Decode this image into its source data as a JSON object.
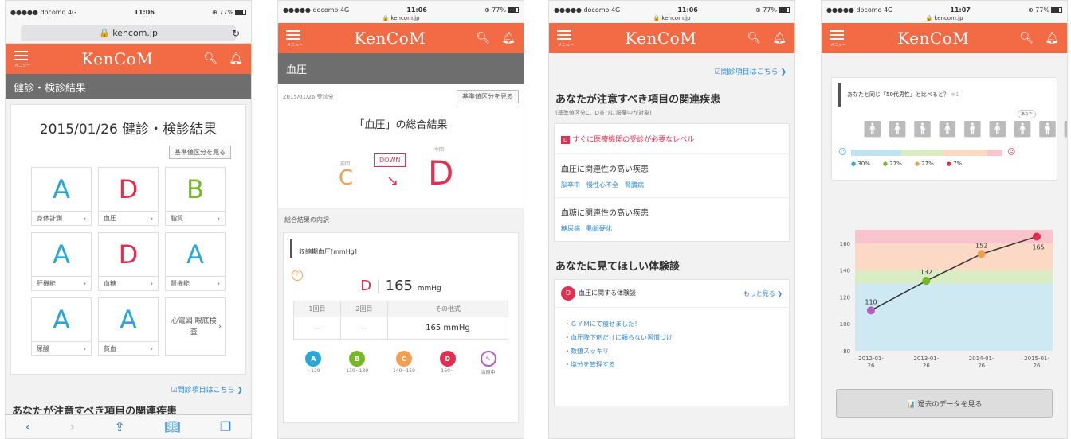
{
  "status": {
    "carrier": "●●●●● docomo 4G",
    "battery": "⊕ 77%"
  },
  "times": [
    "11:06",
    "11:06",
    "11:06",
    "11:07"
  ],
  "host": "kencom.jp",
  "lock_host": "🔒 kencom.jp",
  "host_small": "🔒 kencom.jp",
  "logo": "KenCoM",
  "menu_label": "メニュー",
  "s1": {
    "sub": "健診・検診結果",
    "title": "2015/01/26 健診・検診結果",
    "std": "基準値区分を見る",
    "cards": [
      {
        "g": "A",
        "l": "身体計測"
      },
      {
        "g": "D",
        "l": "血圧"
      },
      {
        "g": "B",
        "l": "脂質"
      },
      {
        "g": "A",
        "l": "肝機能"
      },
      {
        "g": "D",
        "l": "血糖"
      },
      {
        "g": "A",
        "l": "腎機能"
      },
      {
        "g": "A",
        "l": "尿酸"
      },
      {
        "g": "A",
        "l": "貧血"
      },
      {
        "g": "",
        "l": "心電図 眼底検査"
      }
    ],
    "link": "☑問診項目はこちら ❯",
    "heading": "あなたが注意すべき項目の関連疾患"
  },
  "s2": {
    "sub": "血圧",
    "date": "2015/01/26 受診分",
    "std": "基準値区分を見る",
    "title": "「血圧」の総合結果",
    "prev_label": "前回",
    "prev": "C",
    "down": "DOWN",
    "now_label": "今回",
    "now": "D",
    "breakdown": "総合結果の内訳",
    "item": "収縮期血圧[mmHg]",
    "q": "?",
    "grade": "D",
    "value": "165",
    "unit": "mmHg",
    "cols": [
      "1回目",
      "2回目",
      "その他式"
    ],
    "cells": [
      "—",
      "—",
      "165 mmHg"
    ],
    "legend": [
      {
        "k": "A",
        "t": "~129"
      },
      {
        "k": "B",
        "t": "130~139"
      },
      {
        "k": "C",
        "t": "140~159"
      },
      {
        "k": "D",
        "t": "160~"
      },
      {
        "k": "✎",
        "t": "治療中"
      }
    ]
  },
  "s3": {
    "link": "☑問診項目はこちら ❯",
    "heading": "あなたが注意すべき項目の関連疾患",
    "note": "(基準値区分C、D並びに服薬中が対象)",
    "alert": "すぐに医療機関の受診が必要なレベル",
    "alert_icon": "D",
    "h1": "血圧に関連性の高い疾患",
    "k1": "脳卒中　慢性心不全　腎臓病",
    "h2": "血糖に関連性の高い疾患",
    "k2": "糖尿病　動脈硬化",
    "heading2": "あなたに見てほしい体験談",
    "exp_icon": "D",
    "exp": "血圧に関する体験談",
    "more": "もっと見る ❯",
    "tips": [
      "・ＧＹＭにて痩せました！",
      "・血圧降下剤だけに頼らない習慣づけ",
      "・数値スッキリ",
      "・塩分を管理する"
    ]
  },
  "s4": {
    "compare": "あなたと同じ「50代男性」と比べると？",
    "note": "※1",
    "you": "あなた",
    "pct": [
      {
        "c": "#2aa6d8",
        "t": "30%"
      },
      {
        "c": "#76b82a",
        "t": "27%"
      },
      {
        "c": "#f0a050",
        "t": "27%"
      },
      {
        "c": "#e03050",
        "t": "7%"
      }
    ],
    "btn": "📊 過去のデータを見る"
  },
  "chart_data": {
    "type": "line",
    "x": [
      "2012-01-26",
      "2013-01-26",
      "2014-01-26",
      "2015-01-26"
    ],
    "xticks": [
      "2012-01-\n26",
      "2013-01-\n26",
      "2014-01-\n26",
      "2015-01-\n26"
    ],
    "values": [
      110,
      132,
      152,
      165
    ],
    "yticks": [
      80,
      100,
      120,
      140,
      160
    ],
    "ylim": [
      80,
      170
    ],
    "point_colors": [
      "#b05fc0",
      "#76b82a",
      "#f0a050",
      "#e03050"
    ],
    "bands": [
      {
        "from": 80,
        "to": 130,
        "c": "#cfe9f3"
      },
      {
        "from": 130,
        "to": 140,
        "c": "#d9ecc4"
      },
      {
        "from": 140,
        "to": 160,
        "c": "#fbd9c4"
      },
      {
        "from": 160,
        "to": 170,
        "c": "#f9c4cc"
      }
    ]
  }
}
